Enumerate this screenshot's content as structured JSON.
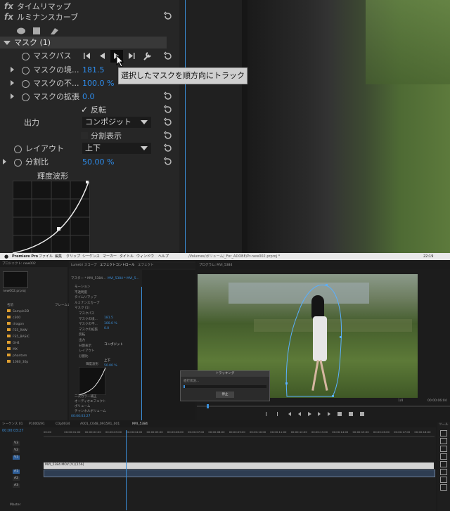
{
  "top": {
    "effects": [
      {
        "fx": "fx",
        "label": "タイムリマップ"
      },
      {
        "fx": "fx",
        "label": "ルミナンスカーブ"
      }
    ],
    "mask_label": "マスク (1)",
    "mask_path_label": "マスクパス",
    "tooltip": "選択したマスクを順方向にトラック",
    "params": [
      {
        "label": "マスクの境...",
        "value": "181.5"
      },
      {
        "label": "マスクの不...",
        "value": "100.0 %"
      },
      {
        "label": "マスクの拡張",
        "value": "0.0"
      }
    ],
    "invert_label": "反転",
    "output_label": "出力",
    "output_value": "コンポジット",
    "split_view_label": "分割表示",
    "layout_label": "レイアウト",
    "layout_value": "上下",
    "split_ratio_label": "分割比",
    "split_ratio_value": "50.00 %",
    "waveform_label": "輝度波形"
  },
  "app": {
    "menubar": {
      "app_name": "Premiere Pro",
      "items": [
        "ファイル",
        "編集",
        "クリップ",
        "シーケンス",
        "マーカー",
        "タイトル",
        "ウィンドウ",
        "ヘルプ"
      ],
      "path": "/Volumes/ボリューム/_For_ADOBE/Pr-new002.prproj *",
      "clock": "22:19"
    },
    "project_panel": {
      "title": "プロジェクト: new002",
      "file": "new002.prproj",
      "col_name": "名前",
      "col_rate": "フレームレ",
      "bins": [
        "Sample3D",
        "c300",
        "dragon",
        "FS5_RAW",
        "FS5_BASIC",
        "GH4",
        "MX",
        "phantom",
        "1080_30p"
      ]
    },
    "effect_controls": {
      "tab_lumetri": "Lumetri スコープ",
      "tab_effects": "エフェクトコントロール",
      "tab_other": "エフェクト",
      "master_label": "マスター * MVI_5384...",
      "clip_label": "MVI_5384 * MVI_5...",
      "clip_chip": "MVI_5384.MOV",
      "rows": [
        "モーション",
        "不透明度",
        "タイムリマップ",
        "ルミナンスカーブ",
        "マスク (1)",
        "マスクパス",
        "マスクの境...",
        "マスクの不...",
        "マスクの拡張",
        "反転",
        "出力",
        "分割表示",
        "レイアウト",
        "分割比"
      ],
      "values": [
        "181.5",
        "100.0 %",
        "0.0",
        "コンポジット",
        "上下",
        "50.00 %"
      ],
      "waveform": "輝度波形",
      "bottom_rows": [
        "二次カラー補正",
        "オーディオエフェクト",
        "ボリューム",
        "チャンネルボリューム"
      ],
      "timecode": "00:00:03:27"
    },
    "program": {
      "title": "プログラム: MVI_5384",
      "timecode_left": "00:00:03:27",
      "fit": "1/4",
      "timecode_right": "00:00:06:04"
    },
    "tracking_dialog": {
      "title": "トラッキング",
      "status": "進行状況...",
      "stop": "停止"
    },
    "timeline": {
      "tabs": [
        "シーケンス 01",
        "P1000291",
        "C0p0034",
        "A001_C048_0915R1_001",
        "MVI_5384"
      ],
      "timecode": "00:00:03:27",
      "ruler": [
        "00:00",
        "00:00:01:00",
        "00:00:02:00",
        "00:00:03:00",
        "00:00:04:00",
        "00:00:05:00",
        "00:00:06:00",
        "00:00:07:00",
        "00:00:08:00",
        "00:00:09:00",
        "00:00:10:00",
        "00:00:11:00",
        "00:00:12:00",
        "00:00:13:00",
        "00:00:14:00",
        "00:00:15:00",
        "00:00:16:00",
        "00:00:17:00",
        "00:00:18:00"
      ],
      "tracks": [
        "V3",
        "V2",
        "V1",
        "A1",
        "A2",
        "A3"
      ],
      "clip_label": "MVI_5384.MOV [V] [156]",
      "master": "Master"
    },
    "tools_label": "ツール"
  }
}
